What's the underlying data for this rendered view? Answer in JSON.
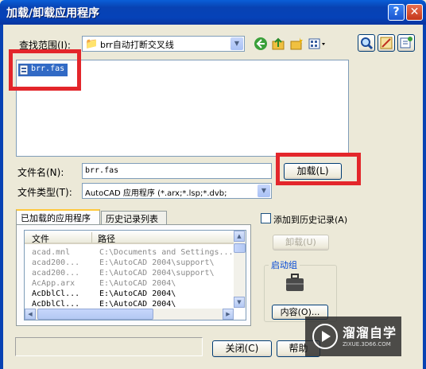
{
  "window": {
    "title": "加载/卸载应用程序",
    "help": "?",
    "close": "✕"
  },
  "lookin": {
    "label": "查找范围(I):",
    "value": "brr自动打断交叉线"
  },
  "files": [
    {
      "name": "brr.fas",
      "selected": true
    }
  ],
  "filename": {
    "label": "文件名(N):",
    "value": "brr.fas"
  },
  "filetype": {
    "label": "文件类型(T):",
    "value": "AutoCAD 应用程序 (*.arx;*.lsp;*.dvb;"
  },
  "buttons": {
    "load": "加载(L)",
    "unload": "卸载(U)",
    "contents": "内容(O)...",
    "close": "关闭(C)",
    "help": "帮助"
  },
  "tabs": [
    {
      "label": "已加载的应用程序",
      "active": true
    },
    {
      "label": "历史记录列表",
      "active": false
    }
  ],
  "list": {
    "columns": [
      "文件",
      "路径"
    ],
    "rows": [
      {
        "file": "acad.mnl",
        "path": "C:\\Documents and Settings...",
        "grey": true
      },
      {
        "file": "acad200...",
        "path": "E:\\AutoCAD 2004\\support\\",
        "grey": true
      },
      {
        "file": "acad200...",
        "path": "E:\\AutoCAD 2004\\support\\",
        "grey": true
      },
      {
        "file": "AcApp.arx",
        "path": "E:\\AutoCAD 2004\\",
        "grey": true
      },
      {
        "file": "AcDblCl...",
        "path": "E:\\AutoCAD 2004\\",
        "grey": false
      },
      {
        "file": "AcDblCl...",
        "path": "E:\\AutoCAD 2004\\",
        "grey": false
      }
    ]
  },
  "history_checkbox": "添加到历史记录(A)",
  "startup_group": "启动组",
  "watermark": {
    "name": "溜溜自学",
    "url": "ZIXUE.3D66.COM"
  }
}
